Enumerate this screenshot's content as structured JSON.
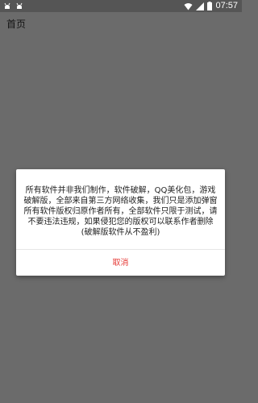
{
  "status_bar": {
    "time": "07:57",
    "left_icons": [
      "android-bug-icon",
      "android-bug-icon"
    ],
    "right_icons": [
      "wifi-icon",
      "signal-icon",
      "battery-icon"
    ]
  },
  "app_bar": {
    "title": "首页"
  },
  "dialog": {
    "message": "所有软件并非我们制作，软件破解，QQ美化包，游戏破解版，全部来自第三方网络收集，我们只是添加弹窗所有软件版权归原作者所有，全部软件只限于测试，请不要违法违规，如果侵犯您的版权可以联系作者删除(破解版软件从不盈利)",
    "cancel_label": "取消"
  },
  "colors": {
    "background": "#6b6b6b",
    "status_bar": "#555555",
    "dialog": "#ffffff",
    "cancel": "#e53935"
  }
}
